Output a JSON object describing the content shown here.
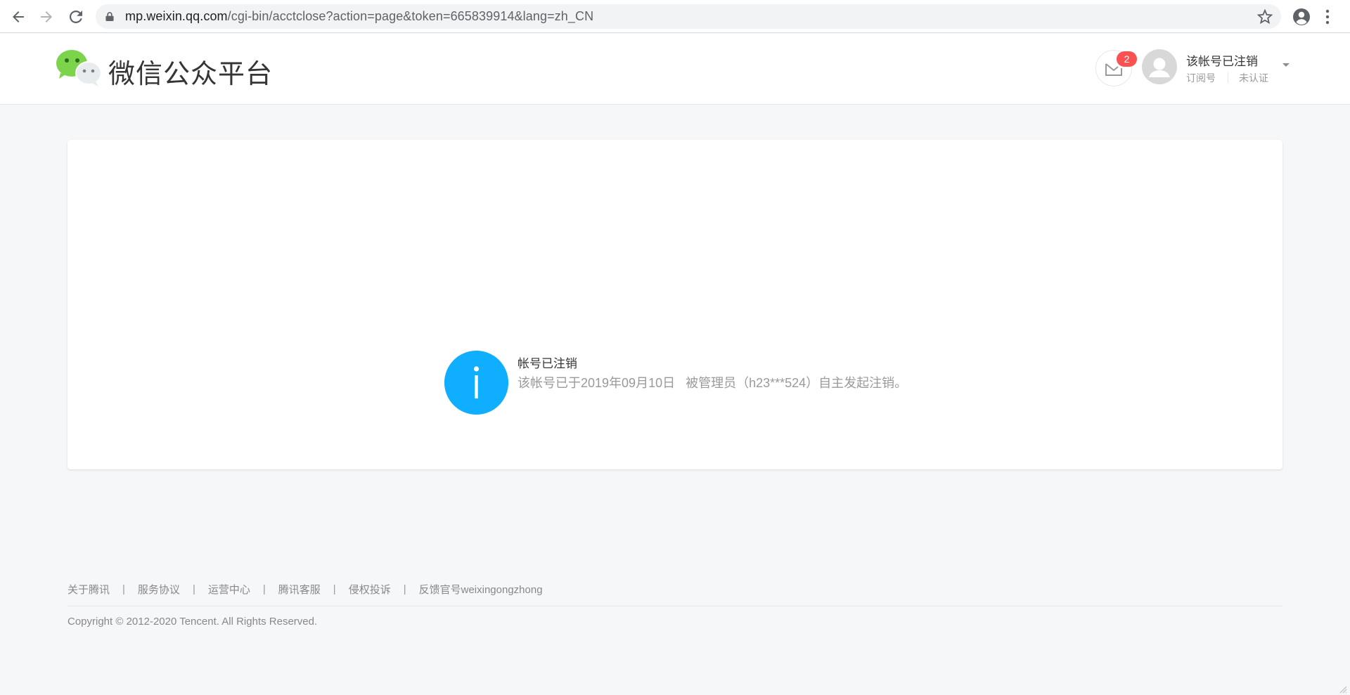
{
  "browser": {
    "url_host": "mp.weixin.qq.com",
    "url_path": "/cgi-bin/acctclose?action=page&token=665839914&lang=zh_CN",
    "icons": [
      "back-icon",
      "forward-icon",
      "reload-icon",
      "lock-icon",
      "star-icon",
      "profile-icon",
      "menu-icon"
    ]
  },
  "header": {
    "logo_text": "微信公众平台",
    "message_badge": "2",
    "account_name": "该帐号已注销",
    "account_type": "订阅号",
    "account_cert": "未认证"
  },
  "notice": {
    "title": "帐号已注销",
    "desc_part1": "该帐号已于2019年09月10日",
    "desc_part2": "被管理员（h23***524）自主发起注销。",
    "icon_color": "#10aeff"
  },
  "footer": {
    "links": [
      "关于腾讯",
      "服务协议",
      "运营中心",
      "腾讯客服",
      "侵权投诉",
      "反馈官号weixingongzhong"
    ],
    "separator": "|",
    "copyright": "Copyright © 2012-2020 Tencent. All Rights Reserved."
  },
  "colors": {
    "brand_green": "#7bd44a",
    "badge_red": "#fa5151",
    "page_bg": "#f6f7f9"
  }
}
